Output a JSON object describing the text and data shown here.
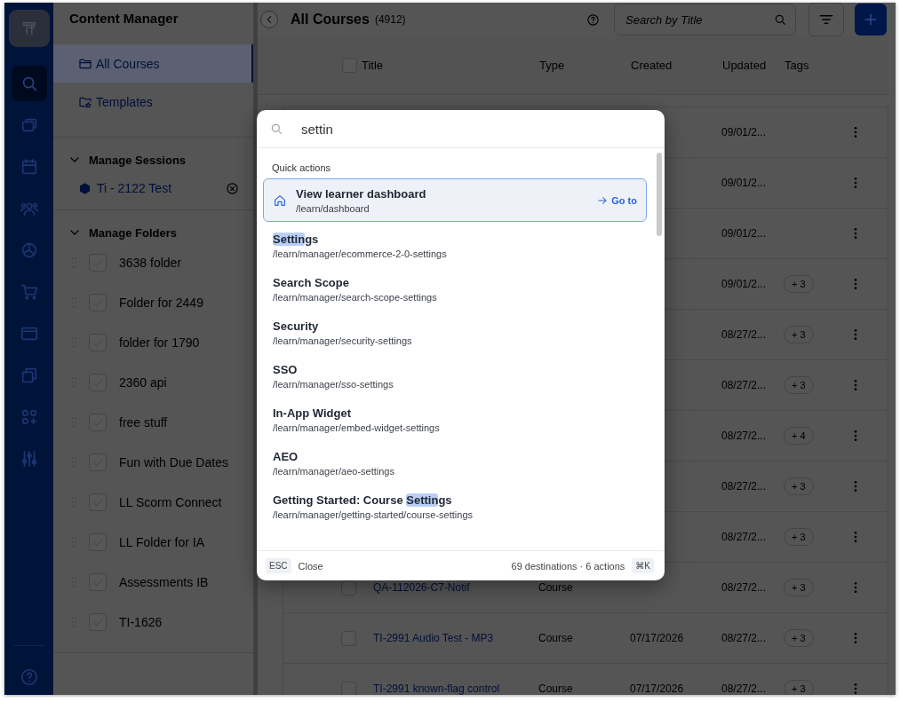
{
  "rail": {
    "items": [
      {
        "selected": false
      },
      {
        "selected": true
      },
      {
        "selected": false
      },
      {
        "selected": false
      },
      {
        "selected": false
      },
      {
        "selected": false
      },
      {
        "selected": false
      },
      {
        "selected": false
      },
      {
        "selected": false
      },
      {
        "selected": false
      },
      {
        "selected": false
      },
      {
        "selected": false
      }
    ]
  },
  "sidebar": {
    "title": "Content Manager",
    "nav": [
      {
        "label": "All Courses",
        "selected": true
      },
      {
        "label": "Templates",
        "selected": false
      }
    ],
    "sections": [
      {
        "title": "Manage Sessions",
        "expanded": true,
        "kind": "sessions",
        "items": [
          {
            "label": "Ti - 2122 Test"
          }
        ]
      },
      {
        "title": "Manage Folders",
        "expanded": true,
        "kind": "folders",
        "items": [
          {
            "label": "3638 folder",
            "checked": false
          },
          {
            "label": "Folder for 2449",
            "checked": false
          },
          {
            "label": "folder for 1790",
            "checked": false
          },
          {
            "label": "2360 api",
            "checked": false
          },
          {
            "label": "free stuff",
            "checked": false
          },
          {
            "label": "Fun with Due Dates",
            "checked": false
          },
          {
            "label": "LL Scorm Connect",
            "checked": false
          },
          {
            "label": "LL Folder for IA",
            "checked": false
          },
          {
            "label": "Assessments IB",
            "checked": false
          },
          {
            "label": "TI-1626",
            "checked": false
          }
        ]
      }
    ]
  },
  "main": {
    "title": "All Courses",
    "count": "(4912)",
    "search": {
      "placeholder": "Search by Title"
    },
    "table": {
      "select_all": {
        "checked": false
      },
      "columns": [
        "Title",
        "Type",
        "Created",
        "Updated",
        "Tags"
      ],
      "rows": [
        {
          "updated": "09/01/2..."
        },
        {
          "updated": "09/01/2..."
        },
        {
          "updated": "09/01/2..."
        },
        {
          "updated": "09/01/2...",
          "tags": "+ 3"
        },
        {
          "updated": "08/27/2...",
          "tags": "+ 3"
        },
        {
          "updated": "08/27/2...",
          "tags": "+ 3"
        },
        {
          "updated": "08/27/2...",
          "tags": "+ 4"
        },
        {
          "updated": "08/27/2...",
          "tags": "+ 3"
        },
        {
          "updated": "08/27/2...",
          "tags": "+ 3"
        },
        {
          "checked": false,
          "title": "QA-112026-C7-Notif",
          "type": "Course",
          "updated": "08/27/2...",
          "tags": "+ 3"
        },
        {
          "checked": false,
          "title": "TI-2991 Audio Test - MP3",
          "type": "Course",
          "created": "07/17/2026",
          "updated": "08/27/2...",
          "tags": "+ 3"
        },
        {
          "checked": false,
          "title": "TI-2991 known-flag control",
          "type": "Course",
          "created": "07/17/2026",
          "updated": "08/27/2...",
          "tags": "+ 3"
        }
      ]
    }
  },
  "palette": {
    "query": "settin",
    "section_label": "Quick actions",
    "items": [
      {
        "kind": "action",
        "selected": true,
        "title": [
          {
            "text": "View learner dashboard",
            "match": false
          }
        ],
        "path": "/learn/dashboard",
        "action": "Go to"
      },
      {
        "kind": "destination",
        "selected": false,
        "title": [
          {
            "text": "Settin",
            "match": true
          },
          {
            "text": "gs",
            "match": false
          }
        ],
        "path": "/learn/manager/ecommerce-2-0-settings"
      },
      {
        "kind": "destination",
        "selected": false,
        "title": [
          {
            "text": "Search Scope",
            "match": false
          }
        ],
        "path": "/learn/manager/search-scope-settings"
      },
      {
        "kind": "destination",
        "selected": false,
        "title": [
          {
            "text": "Security",
            "match": false
          }
        ],
        "path": "/learn/manager/security-settings"
      },
      {
        "kind": "destination",
        "selected": false,
        "title": [
          {
            "text": "SSO",
            "match": false
          }
        ],
        "path": "/learn/manager/sso-settings"
      },
      {
        "kind": "destination",
        "selected": false,
        "title": [
          {
            "text": "In-App Widget",
            "match": false
          }
        ],
        "path": "/learn/manager/embed-widget-settings"
      },
      {
        "kind": "destination",
        "selected": false,
        "title": [
          {
            "text": "AEO",
            "match": false
          }
        ],
        "path": "/learn/manager/aeo-settings"
      },
      {
        "kind": "destination",
        "selected": false,
        "title": [
          {
            "text": "Getting Started: Course ",
            "match": false
          },
          {
            "text": "Settin",
            "match": true
          },
          {
            "text": "gs",
            "match": false
          }
        ],
        "path": "/learn/manager/getting-started/course-settings"
      }
    ],
    "footer": {
      "key": "ESC",
      "close": "Close",
      "summary": "69 destinations · 6 actions",
      "shortcut": "⌘K"
    }
  }
}
